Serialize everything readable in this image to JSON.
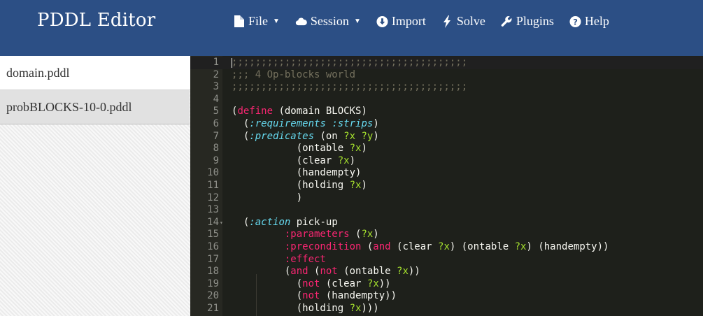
{
  "app": {
    "title": "PDDL Editor"
  },
  "nav": [
    {
      "name": "file",
      "label": "File",
      "icon": "file-icon",
      "dropdown": true
    },
    {
      "name": "session",
      "label": "Session",
      "icon": "cloud-icon",
      "dropdown": true
    },
    {
      "name": "import",
      "label": "Import",
      "icon": "download-circle-icon",
      "dropdown": false
    },
    {
      "name": "solve",
      "label": "Solve",
      "icon": "lightning-bolt-icon",
      "dropdown": false
    },
    {
      "name": "plugins",
      "label": "Plugins",
      "icon": "wrench-icon",
      "dropdown": false
    },
    {
      "name": "help",
      "label": "Help",
      "icon": "question-circle-icon",
      "dropdown": false
    }
  ],
  "files": [
    {
      "name": "domain.pddl",
      "active": true
    },
    {
      "name": "probBLOCKS-10-0.pddl",
      "active": false
    }
  ],
  "editor": {
    "active_line": 1,
    "lines": [
      {
        "n": "1",
        "text": ";;;;;;;;;;;;;;;;;;;;;;;;;;;;;;;;;;;;;;;;"
      },
      {
        "n": "2",
        "text": ";;; 4 Op-blocks world"
      },
      {
        "n": "3",
        "text": ";;;;;;;;;;;;;;;;;;;;;;;;;;;;;;;;;;;;;;;;"
      },
      {
        "n": "4",
        "text": ""
      },
      {
        "n": "5",
        "text": "(define (domain BLOCKS)"
      },
      {
        "n": "6",
        "text": "  (:requirements :strips)"
      },
      {
        "n": "7",
        "text": "  (:predicates (on ?x ?y)"
      },
      {
        "n": "8",
        "text": "           (ontable ?x)"
      },
      {
        "n": "9",
        "text": "           (clear ?x)"
      },
      {
        "n": "10",
        "text": "           (handempty)"
      },
      {
        "n": "11",
        "text": "           (holding ?x)"
      },
      {
        "n": "12",
        "text": "           )"
      },
      {
        "n": "13",
        "text": ""
      },
      {
        "n": "14",
        "text": "  (:action pick-up",
        "fold": true
      },
      {
        "n": "15",
        "text": "         :parameters (?x)"
      },
      {
        "n": "16",
        "text": "         :precondition (and (clear ?x) (ontable ?x) (handempty))"
      },
      {
        "n": "17",
        "text": "         :effect"
      },
      {
        "n": "18",
        "text": "         (and (not (ontable ?x))"
      },
      {
        "n": "19",
        "text": "           (not (clear ?x))"
      },
      {
        "n": "20",
        "text": "           (not (handempty))"
      },
      {
        "n": "21",
        "text": "           (holding ?x)))"
      }
    ]
  },
  "colors": {
    "navbar": "#2c4f85",
    "editor_bg": "#1e201b",
    "gutter_bg": "#272822",
    "comment": "#75715e",
    "keyword": "#f92672",
    "variable": "#a6e22e",
    "builtin": "#66d9ef",
    "text": "#f8f8f2"
  }
}
